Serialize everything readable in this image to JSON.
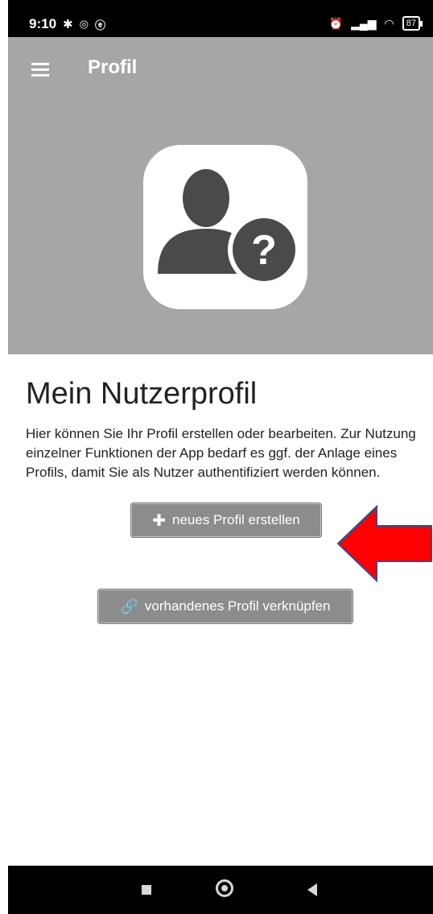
{
  "status_bar": {
    "time": "9:10",
    "battery": "87"
  },
  "app_bar": {
    "title": "Profil"
  },
  "content": {
    "heading": "Mein Nutzerprofil",
    "description": "Hier können Sie Ihr Profil erstellen oder bearbeiten. Zur Nutzung einzelner Funktionen der App bedarf es ggf. der Anlage eines Profils, damit Sie als Nutzer authentifiziert werden können."
  },
  "buttons": {
    "new_profile": "neues Profil erstellen",
    "link_profile": "vorhandenes Profil verknüpfen"
  },
  "icons": {
    "menu": "menu-icon",
    "avatar": "unknown-user-icon",
    "plus": "plus-icon",
    "link": "link-icon"
  },
  "colors": {
    "header_bg": "#a6a6a6",
    "button_bg": "#8c8c8c",
    "arrow": "#ff0000"
  }
}
